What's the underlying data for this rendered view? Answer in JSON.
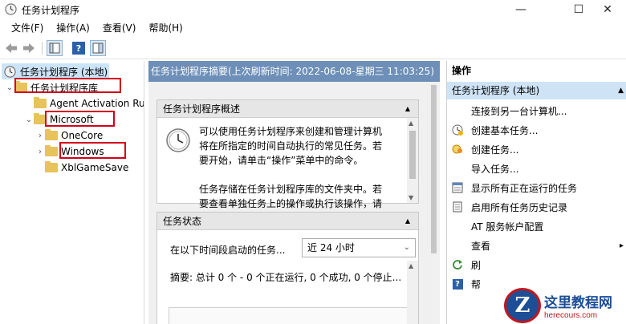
{
  "window": {
    "title": "任务计划程序",
    "minimize": "—",
    "maximize": "☐",
    "close": "✕"
  },
  "menu": [
    "文件(F)",
    "操作(A)",
    "查看(V)",
    "帮助(H)"
  ],
  "toolbar": {
    "back": "back-arrow-icon",
    "forward": "forward-arrow-icon",
    "show_hide": "console-tree-icon",
    "help": "?",
    "panel": "action-pane-icon"
  },
  "tree": {
    "root": "任务计划程序 (本地)",
    "library": "任务计划程序库",
    "items": [
      "Agent Activation Runtime",
      "Microsoft",
      "OneCore",
      "Windows",
      "XblGameSave"
    ]
  },
  "center": {
    "header": "任务计划程序摘要(上次刷新时间: 2022-06-08-星期三 11:03:25)",
    "overview": {
      "title": "任务计划程序概述",
      "paragraph1": [
        "可以使用任务计划程序来创建和管理计算机",
        "将在所指定的时间自动执行的常见任务。若",
        "要开始，请单击“操作”菜单中的命令。"
      ],
      "paragraph2": [
        "任务存储在任务计划程序库的文件夹中。若",
        "要查看单独任务上的操作或执行该操作，请"
      ]
    },
    "status": {
      "title": "任务状态",
      "filter_label": "在以下时间段启动的任务...",
      "filter_value": "近 24 小时",
      "summary": "摘要: 总计 0 个 - 0 个正在运行, 0 个成功, 0 个停止..."
    }
  },
  "actions": {
    "title": "操作",
    "group": "任务计划程序 (本地)",
    "items": [
      {
        "label": "连接到另一台计算机...",
        "icon": ""
      },
      {
        "label": "创建基本任务...",
        "icon": "basic-task-icon"
      },
      {
        "label": "创建任务...",
        "icon": "create-task-icon"
      },
      {
        "label": "导入任务...",
        "icon": ""
      },
      {
        "label": "显示所有正在运行的任务",
        "icon": "running-tasks-icon"
      },
      {
        "label": "启用所有任务历史记录",
        "icon": "history-icon"
      },
      {
        "label": "AT 服务帐户配置",
        "icon": ""
      },
      {
        "label": "查看",
        "icon": ""
      },
      {
        "label": "刷",
        "icon": "refresh-icon"
      },
      {
        "label": "帮",
        "icon": "help-icon"
      }
    ]
  },
  "watermark": {
    "logo": "Z",
    "name": "这里教程网",
    "url": "herecours.com"
  }
}
